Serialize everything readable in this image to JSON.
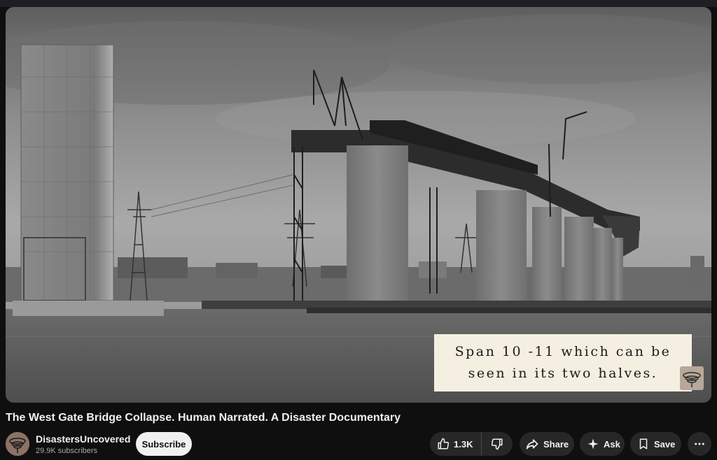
{
  "video": {
    "title": "The West Gate Bridge Collapse. Human Narrated. A Disaster Documentary",
    "caption_line1": "Span 10 -11 which can be",
    "caption_line2": "seen in its two halves."
  },
  "channel": {
    "name": "DisastersUncovered",
    "subscribers": "29.9K subscribers",
    "subscribe_label": "Subscribe"
  },
  "actions": {
    "like_count": "1.3K",
    "share_label": "Share",
    "ask_label": "Ask",
    "save_label": "Save"
  },
  "icons": {
    "like": "thumb-up-icon",
    "dislike": "thumb-down-icon",
    "share": "share-arrow-icon",
    "ask": "sparkle-icon",
    "save": "bookmark-icon",
    "more": "more-horizontal-icon"
  },
  "colors": {
    "background": "#0f0f0f",
    "pill": "#272727",
    "subscribe_bg": "#f1f1f1",
    "caption_bg": "#f4efe1"
  }
}
